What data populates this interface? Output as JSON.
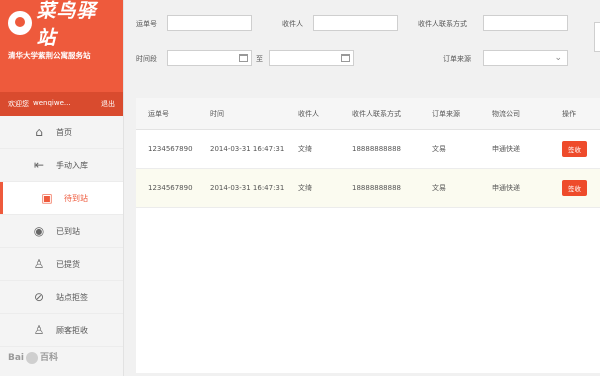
{
  "brand": {
    "logo_text": "菜鸟驿站",
    "subtitle": "清华大学紫荆公寓服务站"
  },
  "userbar": {
    "welcome": "欢迎您",
    "username": "wenqiwe...",
    "logout": "退出"
  },
  "nav": [
    {
      "label": "首页",
      "icon": "home-icon"
    },
    {
      "label": "手动入库",
      "icon": "inbox-icon"
    },
    {
      "label": "待到站",
      "icon": "truck-icon",
      "active": true
    },
    {
      "label": "已到站",
      "icon": "location-pin-icon"
    },
    {
      "label": "已提货",
      "icon": "user-check-icon"
    },
    {
      "label": "站点拒签",
      "icon": "ban-icon"
    },
    {
      "label": "顾客拒收",
      "icon": "user-x-icon"
    }
  ],
  "filters": {
    "waybill_label": "运单号",
    "recipient_label": "收件人",
    "recipient_phone_label": "收件人联系方式",
    "period_label": "时间段",
    "to_label": "至",
    "order_source_label": "订单来源",
    "waybill_value": "",
    "recipient_value": "",
    "phone_value": "",
    "date_from": "",
    "date_to": "",
    "order_source_value": ""
  },
  "table": {
    "headers": [
      "运单号",
      "时间",
      "收件人",
      "收件人联系方式",
      "订单来源",
      "物流公司",
      "操作"
    ],
    "rows": [
      {
        "waybill": "1234567890",
        "time": "2014-03-31 16:47:31",
        "recipient": "文绮",
        "phone": "18888888888",
        "source": "文易",
        "company": "申通快递",
        "action": "签收"
      },
      {
        "waybill": "1234567890",
        "time": "2014-03-31 16:47:31",
        "recipient": "文绮",
        "phone": "18888888888",
        "source": "文易",
        "company": "申通快递",
        "action": "签收"
      }
    ]
  },
  "watermark": {
    "text_left": "Bai",
    "text_right": "百科"
  },
  "colors": {
    "accent": "#ee5a3c",
    "button": "#ee4b2b"
  }
}
